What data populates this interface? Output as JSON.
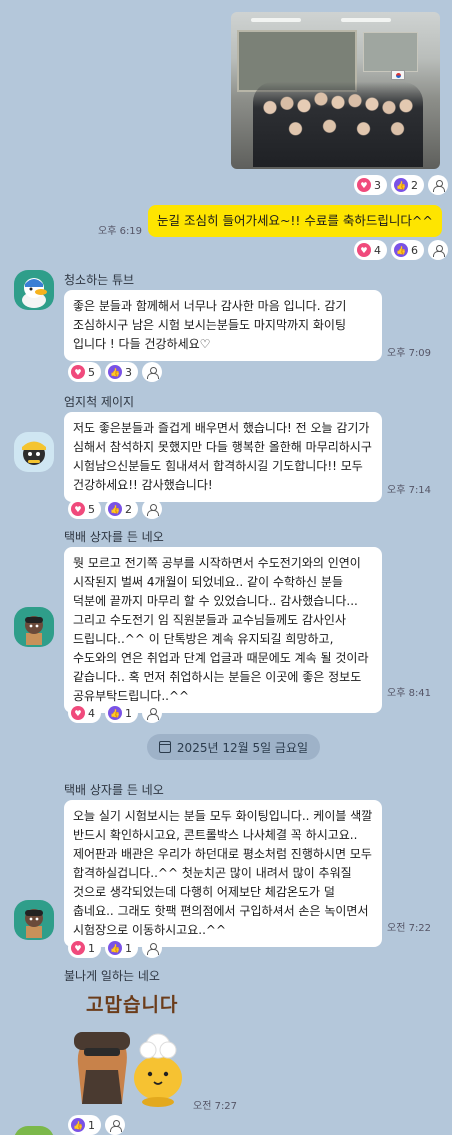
{
  "photo_message": {
    "reactions": {
      "heart": "3",
      "thumb": "2"
    }
  },
  "my_message": {
    "time": "오후 6:19",
    "text": "눈길 조심히 들어가세요~!! 수료를 축하드립니다^^",
    "reactions": {
      "heart": "4",
      "thumb": "6"
    }
  },
  "messages": [
    {
      "sender": "청소하는 튜브",
      "text": "좋은 분들과 함께해서 너무나 감사한 마음 입니다. 감기 조심하시구 남은 시험 보시는분들도 마지막까지 화이팅 입니다 ! 다들 건강하세요♡",
      "time": "오후 7:09",
      "reactions": {
        "heart": "5",
        "thumb": "3"
      }
    },
    {
      "sender": "엄지척 제이지",
      "text": "저도 좋은분들과 즐겁게 배우면서 했습니다! 전 오늘 감기가 심해서 참석하지 못했지만 다들 행복한 올한해 마무리하시구 시험남으신분들도 힘내셔서 합격하시길 기도합니다!! 모두 건강하세요!! 감사했습니다!",
      "time": "오후 7:14",
      "reactions": {
        "heart": "5",
        "thumb": "2"
      }
    },
    {
      "sender": "택배 상자를 든 네오",
      "text": "뭣 모르고 전기쪽 공부를 시작하면서 수도전기와의 인연이 시작된지 벌써 4개월이 되었네요.. 같이 수학하신 분들 덕분에 끝까지 마무리 할 수 있었습니다.. 감사했습니다... 그리고 수도전기 임 직원분들과 교수님들께도 감사인사 드립니다..^^ 이 단톡방은 계속 유지되길 희망하고, 수도와의 연은 취업과 단계 업글과 때문에도 계속 될 것이라 같습니다.. 혹 먼저 취업하시는 분들은 이곳에 좋은 정보도 공유부탁드립니다..^^",
      "time": "오후 8:41",
      "reactions": {
        "heart": "4",
        "thumb": "1"
      }
    },
    {
      "sender": "택배 상자를 든 네오",
      "text": "오늘 실기 시험보시는 분들 모두 화이팅입니다.. 케이블 색깔 반드시 확인하시고요,  콘트롤박스 나사체결 꼭 하시고요..  제어판과 배관은 우리가 하던대로 평소처럼 진행하시면 모두 합격하실겁니다..^^  첫눈치곤  많이 내려서 많이 추워질 것으로 생각되었는데 다행히 어제보단 체감온도가 덜 춥네요..  그래도 핫팩 편의점에서 구입하셔서 손은 녹이면서 시험장으로 이동하시고요..^^",
      "time": "오전 7:22",
      "reactions": {
        "heart": "1",
        "thumb": "1"
      }
    },
    {
      "sender": "불나게 일하는 네오",
      "sticker_text": "고맙습니다",
      "time": "오전 7:27",
      "reactions": {
        "thumb": "1"
      }
    }
  ],
  "date_divider": "2025년 12월 5일 금요일",
  "colors": {
    "background": "#b4c7da",
    "my_bubble": "#fee500",
    "heart": "#f04a7c",
    "thumb": "#7a52e6"
  }
}
